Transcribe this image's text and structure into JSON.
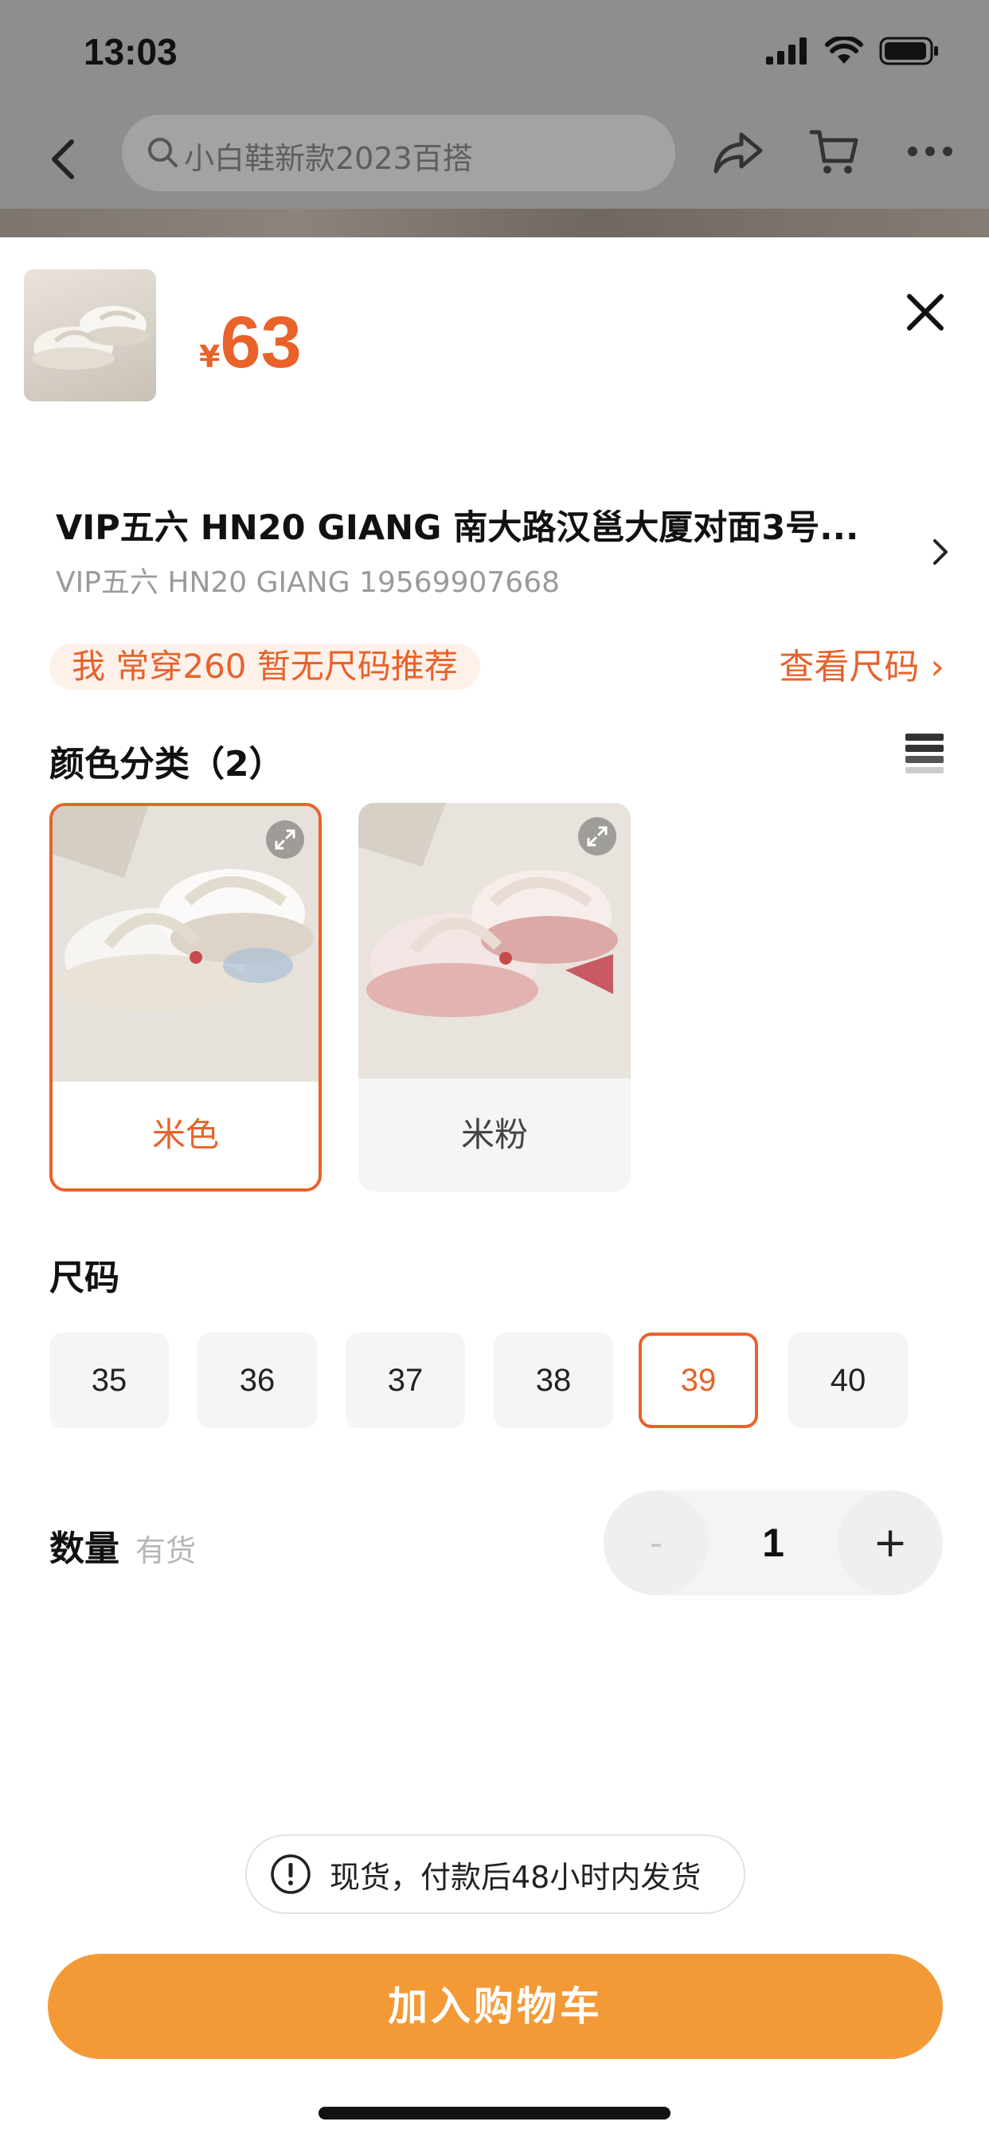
{
  "status_bar": {
    "time": "13:03"
  },
  "nav": {
    "search_placeholder": "小白鞋新款2023百搭"
  },
  "product": {
    "price_symbol": "¥",
    "price": "63"
  },
  "address": {
    "line1": "VIP五六 HN20 GIANG   南大路汉邕大厦对面3号...",
    "line2": "VIP五六  HN20 GIANG 19569907668"
  },
  "size_recommendation": {
    "text": "我 常穿260 暂无尺码推荐",
    "link": "查看尺码 ›"
  },
  "color_section": {
    "heading": "颜色分类（2）",
    "options": [
      {
        "label": "米色",
        "selected": true
      },
      {
        "label": "米粉",
        "selected": false
      }
    ]
  },
  "size_section": {
    "heading": "尺码",
    "options": [
      "35",
      "36",
      "37",
      "38",
      "39",
      "40"
    ],
    "selected": "39"
  },
  "quantity": {
    "label": "数量",
    "stock": "有货",
    "minus": "-",
    "value": "1",
    "plus": "+"
  },
  "shipping_notice": "现货，付款后48小时内发货",
  "add_to_cart_label": "加入购物车",
  "colors": {
    "accent": "#e8622a",
    "cta": "#f39a37"
  }
}
